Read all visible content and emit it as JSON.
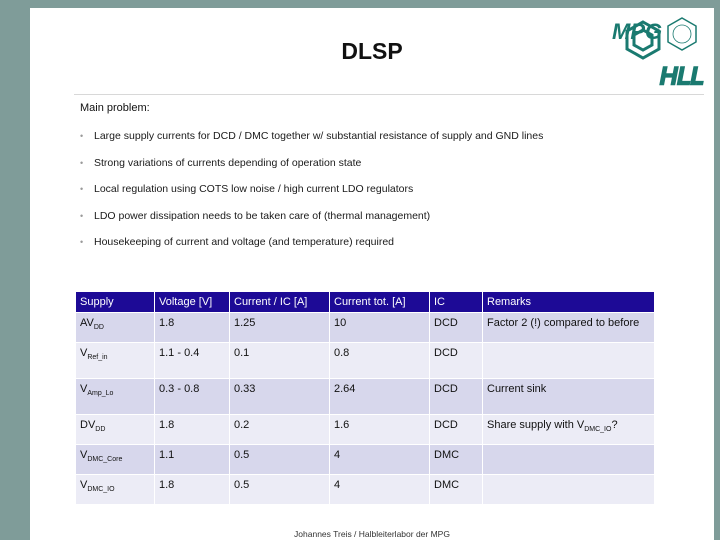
{
  "slide": {
    "title": "DLSP",
    "logo_text": "MPG HLL",
    "heading": "Main problem:",
    "bullets": [
      "Large supply currents for DCD / DMC together w/ substantial resistance of supply and GND lines",
      "Strong variations of currents depending of operation state",
      "Local regulation using COTS low noise / high current LDO regulators",
      "LDO power dissipation needs to be taken care of (thermal management)",
      "Housekeeping of current and voltage (and temperature) required"
    ]
  },
  "table": {
    "headers": [
      "Supply",
      "Voltage [V]",
      "Current / IC  [A]",
      "Current tot.  [A]",
      "IC",
      "Remarks"
    ],
    "rows": [
      {
        "supply_main": "AV",
        "supply_sub": "DD",
        "voltage": "1.8",
        "current_ic": "1.25",
        "current_tot": "10",
        "ic": "DCD",
        "remark_main": "Factor 2 (!) compared to before",
        "remark_sub": "",
        "remark_tail": ""
      },
      {
        "supply_main": "V",
        "supply_sub": "Ref_in",
        "voltage": "1.1  - 0.4",
        "current_ic": "0.1",
        "current_tot": "0.8",
        "ic": "DCD",
        "remark_main": "",
        "remark_sub": "",
        "remark_tail": ""
      },
      {
        "supply_main": "V",
        "supply_sub": "Amp_Lo",
        "voltage": "0.3 - 0.8",
        "current_ic": "0.33",
        "current_tot": "2.64",
        "ic": "DCD",
        "remark_main": "Current sink",
        "remark_sub": "",
        "remark_tail": ""
      },
      {
        "supply_main": "DV",
        "supply_sub": "DD",
        "voltage": "1.8",
        "current_ic": "0.2",
        "current_tot": "1.6",
        "ic": "DCD",
        "remark_main": "Share supply with V",
        "remark_sub": "DMC_IO",
        "remark_tail": "?"
      },
      {
        "supply_main": "V",
        "supply_sub": "DMC_Core",
        "voltage": "1.1",
        "current_ic": "0.5",
        "current_tot": "4",
        "ic": "DMC",
        "remark_main": "",
        "remark_sub": "",
        "remark_tail": ""
      },
      {
        "supply_main": "V",
        "supply_sub": "DMC_IO",
        "voltage": "1.8",
        "current_ic": "0.5",
        "current_tot": "4",
        "ic": "DMC",
        "remark_main": "",
        "remark_sub": "",
        "remark_tail": ""
      }
    ]
  },
  "footer": "Johannes Treis / Halbleiterlabor der MPG",
  "colors": {
    "frame": "#7f9c99",
    "header_bg": "#1d0a96",
    "row_bg": "#d7d7ec",
    "row_alt_bg": "#ececf6",
    "logo": "#1a7a70"
  }
}
